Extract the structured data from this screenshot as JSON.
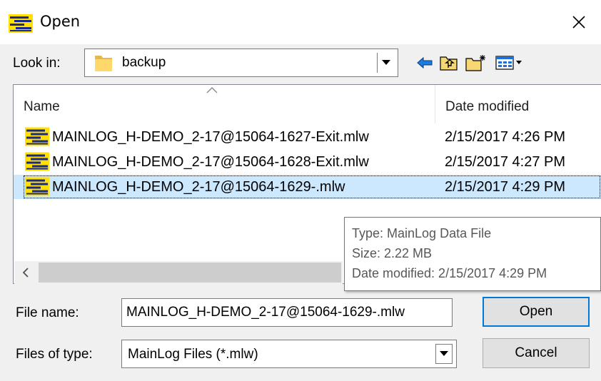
{
  "window": {
    "title": "Open",
    "close_glyph": "✕"
  },
  "lookin": {
    "label": "Look in:",
    "folder": "backup"
  },
  "filelist": {
    "columns": [
      "Name",
      "Date modified"
    ],
    "rows": [
      {
        "name": "MAINLOG_H-DEMO_2-17@15064-1627-Exit.mlw",
        "date": "2/15/2017 4:26 PM",
        "selected": false
      },
      {
        "name": "MAINLOG_H-DEMO_2-17@15064-1628-Exit.mlw",
        "date": "2/15/2017 4:27 PM",
        "selected": false
      },
      {
        "name": "MAINLOG_H-DEMO_2-17@15064-1629-.mlw",
        "date": "2/15/2017 4:29 PM",
        "selected": true
      }
    ]
  },
  "tooltip": {
    "type": "Type: MainLog Data File",
    "size": "Size: 2.22 MB",
    "date": "Date modified: 2/15/2017 4:29 PM"
  },
  "form": {
    "filename_label": "File name:",
    "filename_value": "MAINLOG_H-DEMO_2-17@15064-1629-.mlw",
    "filetype_label": "Files of type:",
    "filetype_value": "MainLog Files (*.mlw)",
    "open_label": "Open",
    "cancel_label": "Cancel"
  },
  "colors": {
    "selection": "#cce8ff",
    "default_button_border": "#0078d7",
    "app_icon_yellow": "#ffe000",
    "app_icon_blue": "#1a2a8a"
  }
}
